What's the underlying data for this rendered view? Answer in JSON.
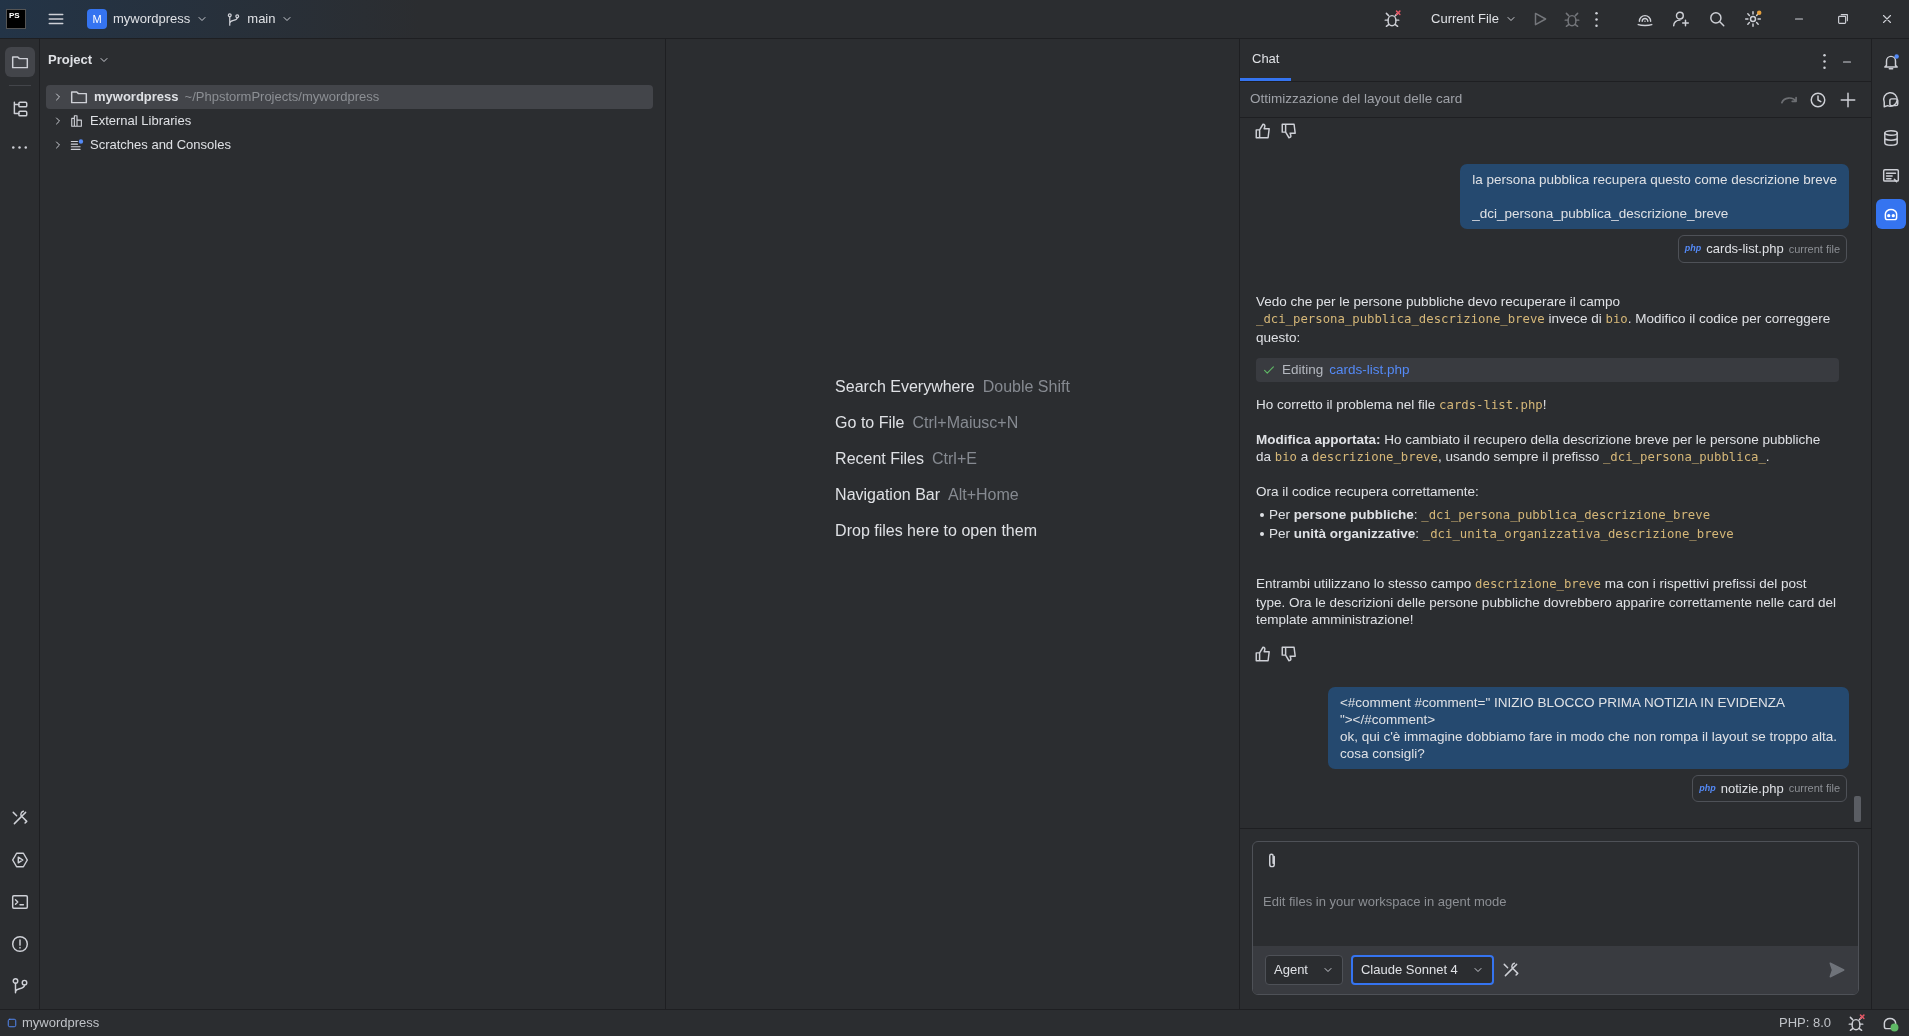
{
  "title_bar": {
    "app_logo": "PS",
    "project_initial": "M",
    "project": "mywordpress",
    "branch": "main",
    "run_config": "Current File"
  },
  "tool_strip_left": [
    {
      "selected": true
    },
    {
      "selected": false
    },
    {
      "selected": false
    }
  ],
  "tool_strip_right": [
    {
      "selected": false
    },
    {
      "selected": false
    },
    {
      "selected": false
    },
    {
      "selected": false
    },
    {
      "selected": true
    }
  ],
  "project_panel": {
    "title": "Project",
    "tree": [
      {
        "kind": "folder",
        "label": "mywordpress",
        "path": "~/PhpstormProjects/mywordpress",
        "selected": true
      },
      {
        "kind": "libraries",
        "label": "External Libraries",
        "selected": false
      },
      {
        "kind": "scratches",
        "label": "Scratches and Consoles",
        "selected": false
      }
    ]
  },
  "editor_hints": [
    {
      "action": "Search Everywhere",
      "shortcut": "Double Shift"
    },
    {
      "action": "Go to File",
      "shortcut": "Ctrl+Maiusc+N"
    },
    {
      "action": "Recent Files",
      "shortcut": "Ctrl+E"
    },
    {
      "action": "Navigation Bar",
      "shortcut": "Alt+Home"
    },
    {
      "action": "Drop files here to open them"
    }
  ],
  "chat": {
    "tabs": [
      {
        "label": "Chat",
        "selected": true
      }
    ],
    "session_title": "Ottimizzazione del layout delle card",
    "messages": [
      {
        "kind": "feedback"
      },
      {
        "kind": "user",
        "paragraphs": [
          [
            "la persona pubblica recupera questo come descrizione breve"
          ],
          [
            "_dci_persona_pubblica_descrizione_breve"
          ]
        ],
        "attachment": {
          "badge": "php",
          "file": "cards-list.php",
          "note": "current file"
        }
      },
      {
        "kind": "assistant",
        "blocks": [
          {
            "kind": "paragraph",
            "parts": [
              {
                "kind": "text",
                "text": "Vedo che per le persone pubbliche devo recuperare il campo "
              },
              {
                "kind": "code",
                "text": "_dci_persona_pubblica_descrizione_breve"
              },
              {
                "kind": "text",
                "text": " invece di "
              },
              {
                "kind": "code",
                "text": "bio"
              },
              {
                "kind": "text",
                "text": ". Modifico il codice per correggere questo:"
              }
            ]
          },
          {
            "kind": "tool",
            "done": true,
            "status": "Editing",
            "file": "cards-list.php"
          },
          {
            "kind": "paragraph",
            "parts": [
              {
                "kind": "text",
                "text": "Ho corretto il problema nel file "
              },
              {
                "kind": "code",
                "text": "cards-list.php"
              },
              {
                "kind": "text",
                "text": "!"
              }
            ]
          },
          {
            "kind": "paragraph",
            "parts": [
              {
                "kind": "text",
                "text": "**Modifica apportata:** Ho cambiato il recupero della descrizione breve per le persone pubbliche da "
              },
              {
                "kind": "code",
                "text": "bio"
              },
              {
                "kind": "text",
                "text": " a "
              },
              {
                "kind": "code",
                "text": "descrizione_breve"
              },
              {
                "kind": "text",
                "text": ", usando sempre il prefisso "
              },
              {
                "kind": "code",
                "text": "_dci_persona_pubblica_"
              },
              {
                "kind": "text",
                "text": "."
              }
            ]
          },
          {
            "kind": "paragraph",
            "parts": [
              {
                "kind": "text",
                "text": "Ora il codice recupera correttamente:"
              }
            ]
          },
          {
            "kind": "bullets",
            "items": [
              [
                {
                  "kind": "text",
                  "text": "Per **persone pubbliche**: "
                },
                {
                  "kind": "code",
                  "text": "_dci_persona_pubblica_descrizione_breve"
                }
              ],
              [
                {
                  "kind": "text",
                  "text": "Per **unità organizzative**: "
                },
                {
                  "kind": "code",
                  "text": "_dci_unita_organizzativa_descrizione_breve"
                }
              ]
            ]
          },
          {
            "kind": "paragraph",
            "parts": [
              {
                "kind": "text",
                "text": "Entrambi utilizzano lo stesso campo "
              },
              {
                "kind": "code",
                "text": "descrizione_breve"
              },
              {
                "kind": "text",
                "text": " ma con i rispettivi prefissi del post type. Ora le descrizioni delle persone pubbliche dovrebbero apparire correttamente nelle card del template amministrazione!"
              }
            ]
          }
        ]
      },
      {
        "kind": "feedback"
      },
      {
        "kind": "user",
        "paragraphs": [
          [
            "<#comment #comment=\" INIZIO BLOCCO PRIMA NOTIZIA IN EVIDENZA",
            "\"></#comment>",
            "ok, qui c'è immagine dobbiamo fare in modo che non rompa il layout se troppo alta.",
            "cosa consigli?"
          ]
        ],
        "attachment": {
          "badge": "php",
          "file": "notizie.php",
          "note": "current file"
        }
      }
    ],
    "input": {
      "placeholder": "Edit files in your workspace in agent mode",
      "selectors": [
        {
          "label": "Agent",
          "focused": false
        },
        {
          "label": "Claude Sonnet 4",
          "focused": true
        }
      ]
    }
  },
  "status_bar": {
    "project": "mywordpress",
    "php_version": "PHP: 8.0"
  }
}
